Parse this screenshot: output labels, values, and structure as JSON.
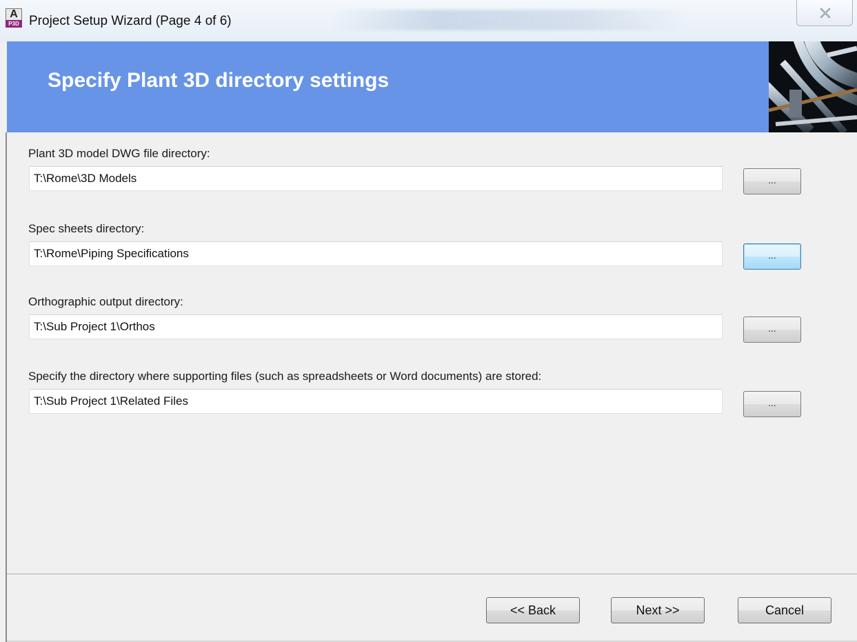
{
  "window": {
    "title": "Project Setup Wizard (Page 4 of 6)",
    "app_icon": {
      "name": "autocad-plant3d-icon",
      "top_glyph": "A",
      "bottom_glyph": "P3D"
    }
  },
  "banner": {
    "title": "Specify Plant 3D directory settings",
    "color": "#6794e6"
  },
  "fields": [
    {
      "label": "Plant 3D model DWG file directory:",
      "value": "T:\\Rome\\3D Models",
      "browse_label": "..."
    },
    {
      "label": "Spec sheets directory:",
      "value": "T:\\Rome\\Piping Specifications",
      "browse_label": "..."
    },
    {
      "label": "Orthographic output directory:",
      "value": "T:\\Sub Project 1\\Orthos",
      "browse_label": "..."
    },
    {
      "label": "Specify the directory where supporting files (such as spreadsheets or Word documents) are stored:",
      "value": "T:\\Sub Project 1\\Related Files",
      "browse_label": "..."
    }
  ],
  "footer": {
    "back_label": "<< Back",
    "next_label": "Next >>",
    "cancel_label": "Cancel"
  }
}
